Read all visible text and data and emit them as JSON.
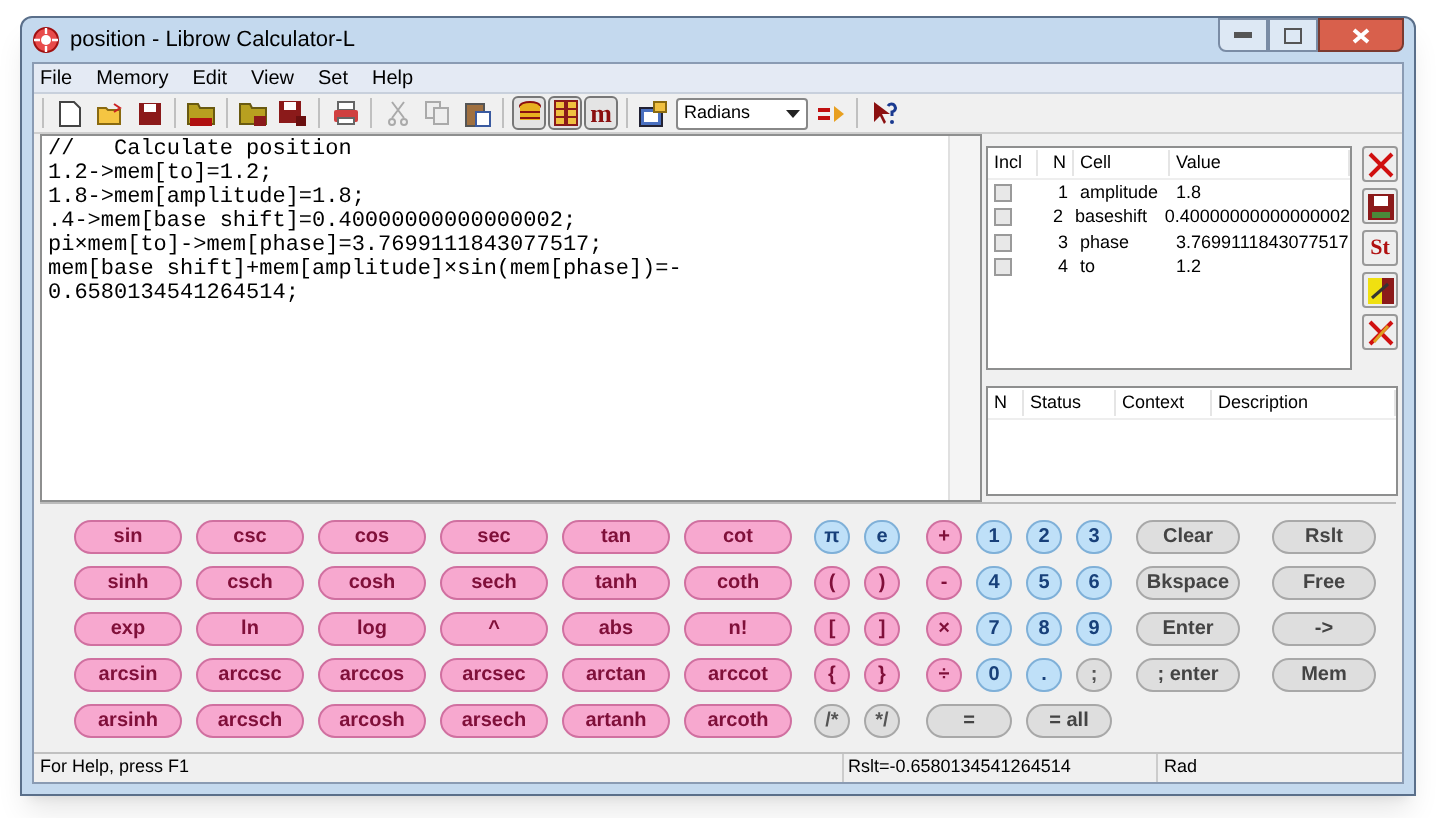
{
  "window": {
    "title": "position - Librow Calculator-L"
  },
  "menu": [
    "File",
    "Memory",
    "Edit",
    "View",
    "Set",
    "Help"
  ],
  "toolbar": {
    "m_glyph": "m",
    "angle_dropdown": "Radians"
  },
  "editor": {
    "lines": [
      "//   Calculate position",
      "1.2->mem[to]=1.2;",
      "1.8->mem[amplitude]=1.8;",
      ".4->mem[base shift]=0.40000000000000002;",
      "pi×mem[to]->mem[phase]=3.7699111843077517;",
      "mem[base shift]+mem[amplitude]×sin(mem[phase])=-",
      "0.6580134541264514;"
    ]
  },
  "memory_table": {
    "columns": [
      "Incl",
      "N",
      "Cell",
      "Value"
    ],
    "rows": [
      {
        "checked": false,
        "n": "1",
        "cell": "amplitude",
        "value": "1.8"
      },
      {
        "checked": false,
        "n": "2",
        "cell": "baseshift",
        "value": "0.40000000000000002"
      },
      {
        "checked": false,
        "n": "3",
        "cell": "phase",
        "value": "3.7699111843077517"
      },
      {
        "checked": false,
        "n": "4",
        "cell": "to",
        "value": "1.2"
      }
    ]
  },
  "memory_tools": {
    "st_glyph": "St"
  },
  "messages_table": {
    "columns": [
      "N",
      "Status",
      "Context",
      "Description"
    ]
  },
  "keypad": {
    "rows": [
      {
        "functions": [
          "sin",
          "csc",
          "cos",
          "sec",
          "tan",
          "cot"
        ],
        "pair": [
          {
            "label": "π",
            "kind": "blue"
          },
          {
            "label": "e",
            "kind": "blue"
          }
        ],
        "numpad": [
          {
            "label": "+",
            "kind": "pink"
          },
          {
            "label": "1",
            "kind": "blue"
          },
          {
            "label": "2",
            "kind": "blue"
          },
          {
            "label": "3",
            "kind": "blue"
          }
        ],
        "commands": [
          "Clear",
          "Rslt"
        ]
      },
      {
        "functions": [
          "sinh",
          "csch",
          "cosh",
          "sech",
          "tanh",
          "coth"
        ],
        "pair": [
          {
            "label": "(",
            "kind": "pink"
          },
          {
            "label": ")",
            "kind": "pink"
          }
        ],
        "numpad": [
          {
            "label": "-",
            "kind": "pink"
          },
          {
            "label": "4",
            "kind": "blue"
          },
          {
            "label": "5",
            "kind": "blue"
          },
          {
            "label": "6",
            "kind": "blue"
          }
        ],
        "commands": [
          "Bkspace",
          "Free"
        ]
      },
      {
        "functions": [
          "exp",
          "ln",
          "log",
          "^",
          "abs",
          "n!"
        ],
        "pair": [
          {
            "label": "[",
            "kind": "pink"
          },
          {
            "label": "]",
            "kind": "pink"
          }
        ],
        "numpad": [
          {
            "label": "×",
            "kind": "pink"
          },
          {
            "label": "7",
            "kind": "blue"
          },
          {
            "label": "8",
            "kind": "blue"
          },
          {
            "label": "9",
            "kind": "blue"
          }
        ],
        "commands": [
          "Enter",
          "->"
        ]
      },
      {
        "functions": [
          "arcsin",
          "arccsc",
          "arccos",
          "arcsec",
          "arctan",
          "arccot"
        ],
        "pair": [
          {
            "label": "{",
            "kind": "pink"
          },
          {
            "label": "}",
            "kind": "pink"
          }
        ],
        "numpad": [
          {
            "label": "÷",
            "kind": "pink"
          },
          {
            "label": "0",
            "kind": "blue"
          },
          {
            "label": ".",
            "kind": "blue"
          },
          {
            "label": ";",
            "kind": "gray"
          }
        ],
        "commands": [
          "; enter",
          "Mem"
        ]
      },
      {
        "functions": [
          "arsinh",
          "arcsch",
          "arcosh",
          "arsech",
          "artanh",
          "arcoth"
        ],
        "pair": [
          {
            "label": "/*",
            "kind": "gray"
          },
          {
            "label": "*/",
            "kind": "gray"
          }
        ],
        "numpad": [
          {
            "label": "=",
            "kind": "gray-wide"
          },
          {
            "label": "= all",
            "kind": "gray-wide"
          }
        ],
        "commands": []
      }
    ]
  },
  "status_bar": {
    "help": "For Help, press F1",
    "result": "Rslt=-0.6580134541264514",
    "angle_mode": "Rad"
  }
}
